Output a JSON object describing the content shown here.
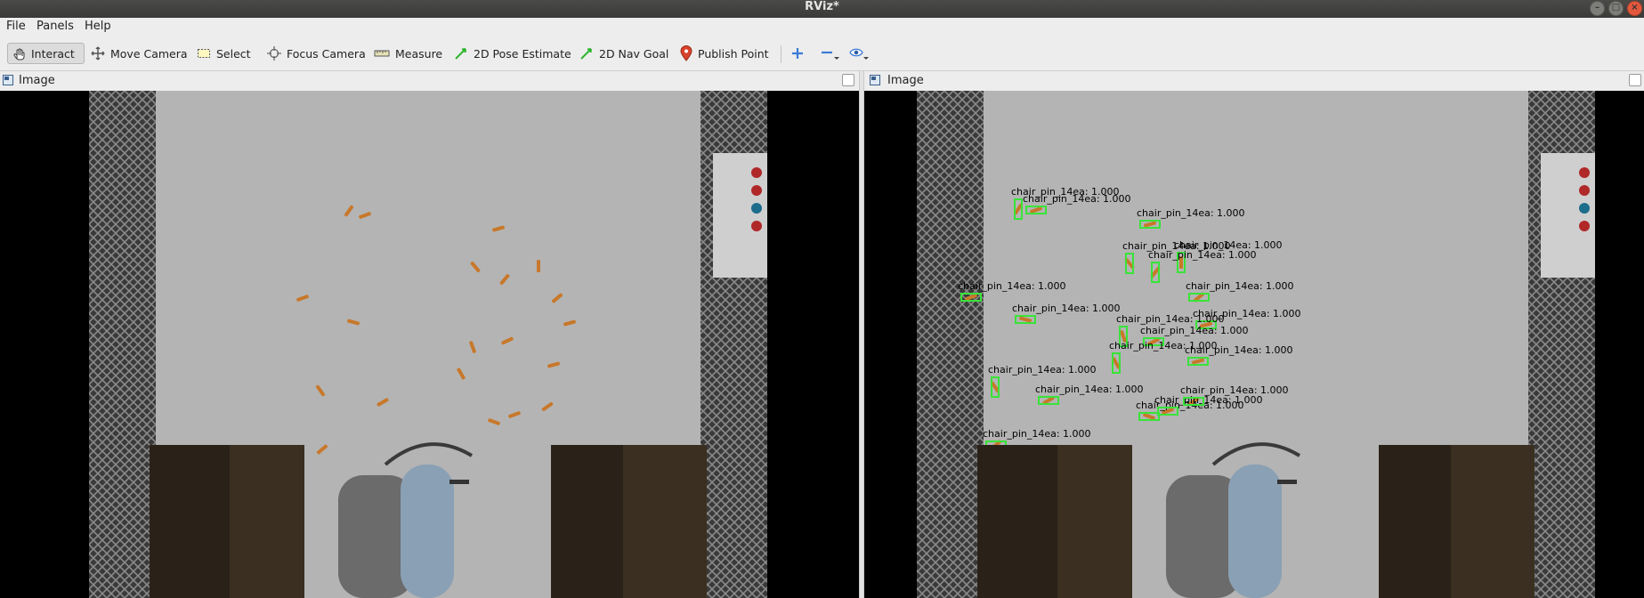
{
  "window": {
    "title": "RViz*"
  },
  "menu": [
    "File",
    "Panels",
    "Help"
  ],
  "toolbar": {
    "tools": [
      {
        "label": "Interact",
        "icon": "hand-cursor-icon",
        "active": true
      },
      {
        "label": "Move Camera",
        "icon": "move-camera-icon"
      },
      {
        "label": "Select",
        "icon": "select-rect-icon"
      },
      {
        "label": "Focus Camera",
        "icon": "crosshair-icon"
      },
      {
        "label": "Measure",
        "icon": "ruler-icon"
      },
      {
        "label": "2D Pose Estimate",
        "icon": "green-arrow-icon"
      },
      {
        "label": "2D Nav Goal",
        "icon": "green-arrow-icon"
      },
      {
        "label": "Publish Point",
        "icon": "map-pin-icon"
      }
    ],
    "add_icon": "plus-icon",
    "remove_icon": "minus-icon",
    "view_icon": "eye-icon"
  },
  "panels": [
    {
      "title": "Image",
      "checkbox_checked": false
    },
    {
      "title": "Image",
      "checkbox_checked": false
    }
  ],
  "detections": [
    {
      "label": "chair_pin_14ea: 1.000",
      "score": 1.0
    },
    {
      "label": "chair_pin_14ea: 1.000",
      "score": 1.0
    },
    {
      "label": "chair_pin_14ea: 1.000",
      "score": 1.0
    },
    {
      "label": "chair_pin_14ea: 1.000",
      "score": 1.0
    },
    {
      "label": "chair_pin_14ea: 1.000",
      "score": 1.0
    },
    {
      "label": "chair_pin_14ea: 1.000",
      "score": 1.0
    },
    {
      "label": "chair_pin_14ea: 1.000",
      "score": 1.0
    },
    {
      "label": "chair_pin_14ea: 1.000",
      "score": 1.0
    },
    {
      "label": "chair_pin_14ea: 1.000",
      "score": 1.0
    },
    {
      "label": "chair_pin_14ea: 1.000",
      "score": 1.0
    },
    {
      "label": "chair_pin_14ea: 1.000",
      "score": 1.0
    },
    {
      "label": "chair_pin_14ea: 1.000",
      "score": 1.0
    },
    {
      "label": "chair_pin_14ea: 1.000",
      "score": 1.0
    },
    {
      "label": "chair_pin_14ea: 1.000",
      "score": 1.0
    },
    {
      "label": "chair_pin_14ea: 1.000",
      "score": 1.0
    },
    {
      "label": "chair_pin_14ea: 1.000",
      "score": 1.0
    },
    {
      "label": "chair_pin_14ea: 1.000",
      "score": 1.0
    },
    {
      "label": "chair_pin_14ea: 1.000",
      "score": 1.0
    },
    {
      "label": "chair_pin_14ea: 1.000",
      "score": 1.0
    },
    {
      "label": "chair_pin_14ea: 1.000",
      "score": 1.0
    }
  ],
  "colors": {
    "detection_box": "#39e339",
    "pin": "#c8782a",
    "floor": "#b4b4b4",
    "window_titlebar": "#3f3f3d",
    "close_button": "#e2583e"
  }
}
